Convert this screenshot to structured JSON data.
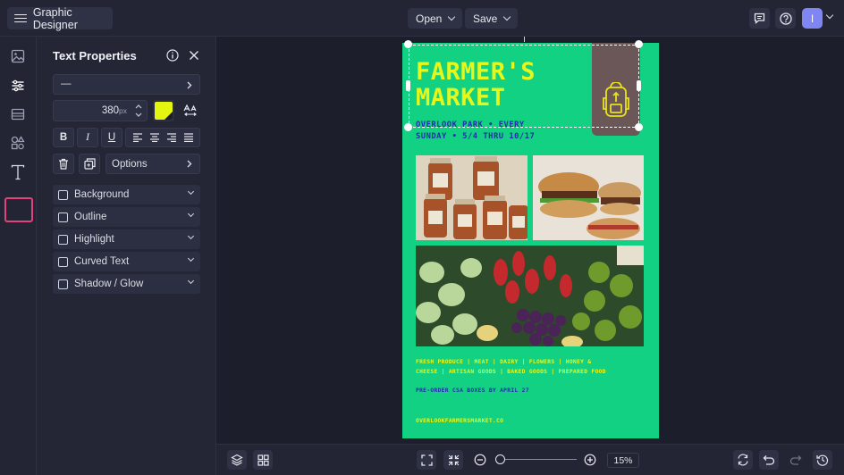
{
  "app": {
    "title": "Graphic Designer"
  },
  "topbar": {
    "open_label": "Open",
    "save_label": "Save",
    "avatar_initial": "I"
  },
  "panel": {
    "title": "Text Properties",
    "font_select_value": "—",
    "font_size_value": "380",
    "font_size_unit": "px",
    "text_color": "#e4f510",
    "bold_label": "B",
    "italic_label": "I",
    "underline_label": "U",
    "options_label": "Options",
    "effects": [
      {
        "label": "Background"
      },
      {
        "label": "Outline"
      },
      {
        "label": "Highlight"
      },
      {
        "label": "Curved Text"
      },
      {
        "label": "Shadow / Glow"
      }
    ]
  },
  "poster": {
    "title_line1": "FARMER'S",
    "title_line2": "MARKET",
    "subtitle_line1": "OVERLOOK PARK • EVERY",
    "subtitle_line2": "SUNDAY • 5/4 THRU 10/17",
    "products_line1": "FRESH PRODUCE | MEAT | DAIRY | FLOWERS | HONEY &",
    "products_line2": "CHEESE | ARTISAN GOODS | BAKED GOODS | PREPARED FOOD",
    "preorder": "PRE-ORDER CSA BOXES BY APRIL 27",
    "website": "OVERLOOKFARMERSMARKET.CO"
  },
  "bottombar": {
    "zoom_level": "15%",
    "zoom_slider_fraction": 0.05
  },
  "colors": {
    "accent_selected": "#e0447a",
    "poster_bg": "#12d182",
    "poster_title": "#e8f71a",
    "poster_subtitle": "#1f2fa8",
    "avatar": "#7f86f4"
  }
}
